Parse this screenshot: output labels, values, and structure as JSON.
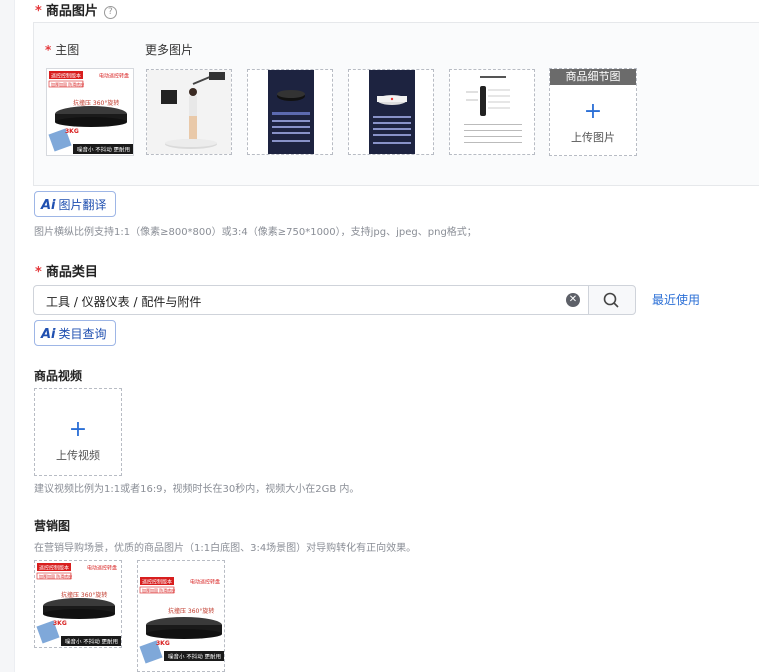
{
  "images_section": {
    "title": "商品图片",
    "help_icon": "question-circle-icon",
    "main_label": "主图",
    "more_label": "更多图片",
    "main_image": {
      "banner_left": "遥控控制版本",
      "banner_right": "电动遥控转盘",
      "sub_tag": "加厚加固 防滑底座",
      "caption": "抗撞压 360°旋转",
      "footer": "噪音小 不抖动 更耐用",
      "badge": "3KG"
    },
    "more_images": [
      {
        "kind": "product-photo"
      },
      {
        "kind": "poster-dark"
      },
      {
        "kind": "poster-dark-white"
      },
      {
        "kind": "manual-sheet"
      }
    ],
    "detail_card": {
      "tag": "商品细节图",
      "plus": "+",
      "label": "上传图片"
    },
    "ai_translate": {
      "ai": "Ai",
      "label": "图片翻译"
    },
    "hint": "图片横纵比例支持1:1（像素≥800*800）或3:4（像素≥750*1000），支持jpg、jpeg、png格式；"
  },
  "category_section": {
    "title": "商品类目",
    "value": "工具 / 仪器仪表 / 配件与附件",
    "clear_icon": "clear-circle-icon",
    "search_icon": "search-icon",
    "recent_label": "最近使用",
    "ai_query": {
      "ai": "Ai",
      "label": "类目查询"
    }
  },
  "video_section": {
    "title": "商品视频",
    "plus": "+",
    "upload_label": "上传视频",
    "hint": "建议视频比例为1:1或者16:9，视频时长在30秒内，视频大小在2GB 内。"
  },
  "marketing_section": {
    "title": "营销图",
    "hint": "在营销导购场景，优质的商品图片（1:1白底图、3:4场景图）对导购转化有正向效果。"
  },
  "colors": {
    "accent": "#2b6fd6",
    "required": "#e4393c",
    "hint": "#8a8e96"
  }
}
